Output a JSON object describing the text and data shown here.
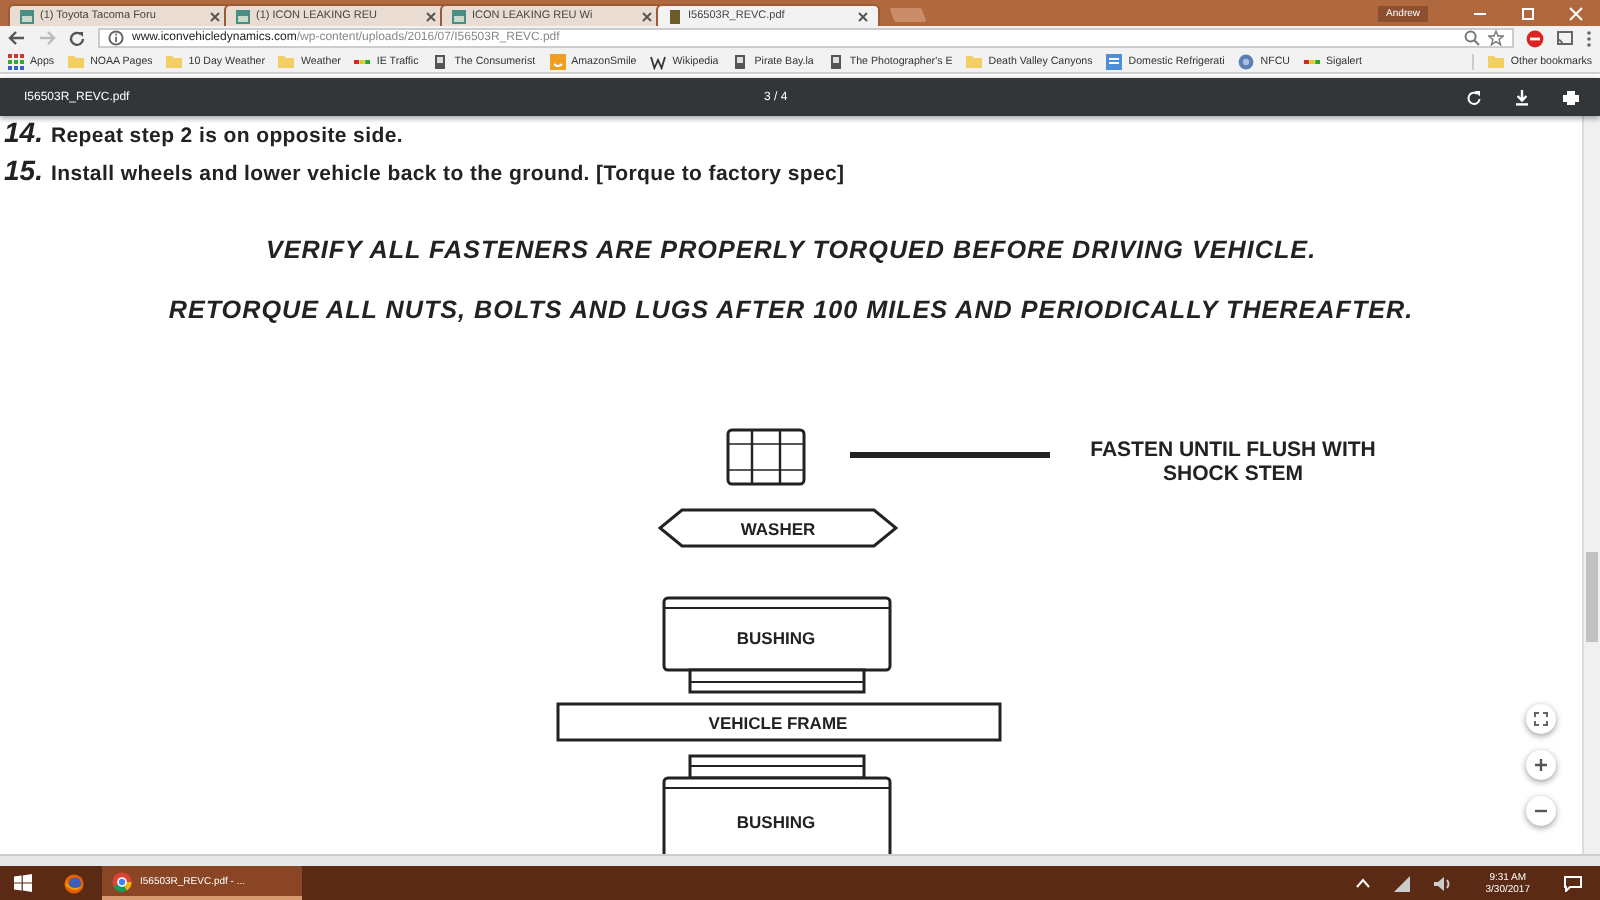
{
  "browser": {
    "tabs": [
      {
        "title": "(1) Toyota Tacoma Foru",
        "selected": false
      },
      {
        "title": "(1) ICON LEAKING REU",
        "selected": false
      },
      {
        "title": "ICON LEAKING REU Wi",
        "selected": false
      },
      {
        "title": "I56503R_REVC.pdf",
        "selected": true
      }
    ],
    "profile": "Andrew",
    "address_bar": {
      "host": "www.iconvehicledynamics.com",
      "path": "/wp-content/uploads/2016/07/I56503R_REVC.pdf"
    },
    "bookmarks": [
      {
        "label": "Apps",
        "kind": "apps"
      },
      {
        "label": "NOAA Pages",
        "kind": "folder"
      },
      {
        "label": "10 Day Weather",
        "kind": "folder"
      },
      {
        "label": "Weather",
        "kind": "folder"
      },
      {
        "label": "IE Traffic",
        "kind": "traffic"
      },
      {
        "label": "The Consumerist",
        "kind": "site"
      },
      {
        "label": "AmazonSmile",
        "kind": "amazon"
      },
      {
        "label": "Wikipedia",
        "kind": "wiki"
      },
      {
        "label": "Pirate Bay.la",
        "kind": "site"
      },
      {
        "label": "The Photographer's E",
        "kind": "site"
      },
      {
        "label": "Death Valley Canyons",
        "kind": "folder"
      },
      {
        "label": "Domestic Refrigerati",
        "kind": "doc"
      },
      {
        "label": "NFCU",
        "kind": "globe"
      },
      {
        "label": "Sigalert",
        "kind": "traffic"
      }
    ],
    "other_bookmarks": "Other bookmarks"
  },
  "pdf_viewer": {
    "title": "I56503R_REVC.pdf",
    "page_indicator": "3 / 4",
    "steps": [
      {
        "number": "14.",
        "text": "Repeat step 2 is on opposite side."
      },
      {
        "number": "15.",
        "text": "Install wheels and lower vehicle back to the ground. [Torque to factory spec]"
      }
    ],
    "warnings": [
      "VERIFY ALL FASTENERS ARE PROPERLY TORQUED BEFORE DRIVING VEHICLE.",
      "RETORQUE ALL NUTS, BOLTS AND LUGS AFTER 100 MILES AND PERIODICALLY THEREAFTER."
    ],
    "diagram": {
      "callout": "FASTEN UNTIL FLUSH WITH SHOCK STEM",
      "parts": [
        {
          "kind": "nut"
        },
        {
          "kind": "washer",
          "label": "WASHER"
        },
        {
          "kind": "bushing_upper",
          "label": "BUSHING"
        },
        {
          "kind": "frame",
          "label": "VEHICLE FRAME"
        },
        {
          "kind": "bushing_lower",
          "label": "BUSHING"
        }
      ]
    }
  },
  "taskbar": {
    "items": [
      {
        "kind": "start"
      },
      {
        "kind": "firefox"
      },
      {
        "kind": "chrome",
        "label": "I56503R_REVC.pdf - ...",
        "selected": true
      }
    ],
    "clock": {
      "time": "9:31 AM",
      "date": "3/30/2017"
    }
  }
}
